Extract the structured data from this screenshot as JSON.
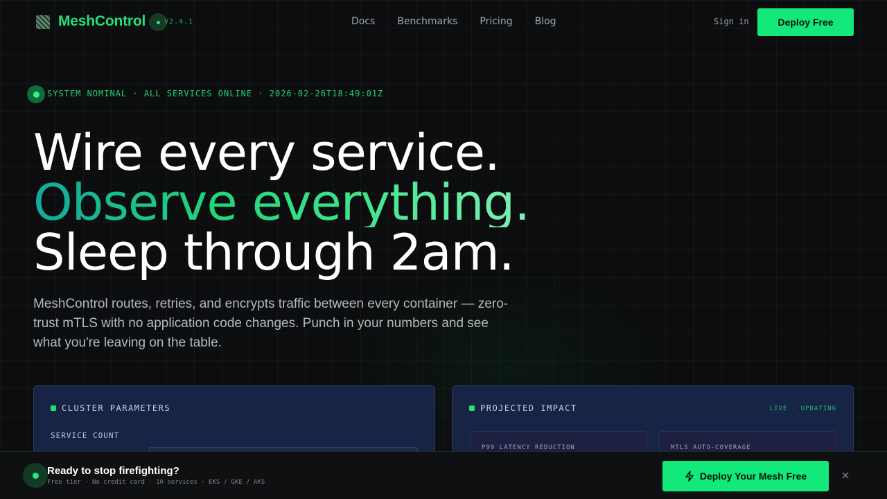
{
  "brand": {
    "name": "MeshControl",
    "version": "V2.4.1"
  },
  "nav": {
    "links": [
      "Docs",
      "Benchmarks",
      "Pricing",
      "Blog"
    ],
    "signin": "Sign in",
    "deploy": "Deploy Free"
  },
  "status": {
    "text": "SYSTEM NOMINAL · ALL SERVICES ONLINE · 2026-02-26T18:49:01Z"
  },
  "hero": {
    "line1": "Wire every service.",
    "line2": "Observe everything.",
    "line3": "Sleep through 2am.",
    "subtitle": "MeshControl routes, retries, and encrypts traffic between every container — zero-trust mTLS with no application code changes. Punch in your numbers and see what you're leaving on the table."
  },
  "cluster_panel": {
    "title": "CLUSTER PARAMETERS",
    "service_count_label": "SERVICE COUNT"
  },
  "impact_panel": {
    "title": "PROJECTED IMPACT",
    "live": "LIVE · UPDATING",
    "metric_a": "P99 LATENCY REDUCTION",
    "metric_b": "MTLS AUTO-COVERAGE"
  },
  "cta": {
    "title": "Ready to stop firefighting?",
    "subtitle": "Free tier · No credit card · 10 services · EKS / GKE / AKS",
    "button": "Deploy Your Mesh Free",
    "close": "×"
  },
  "colors": {
    "accent": "#13e87a",
    "panel": "#182446",
    "background": "#0c0d0e"
  }
}
